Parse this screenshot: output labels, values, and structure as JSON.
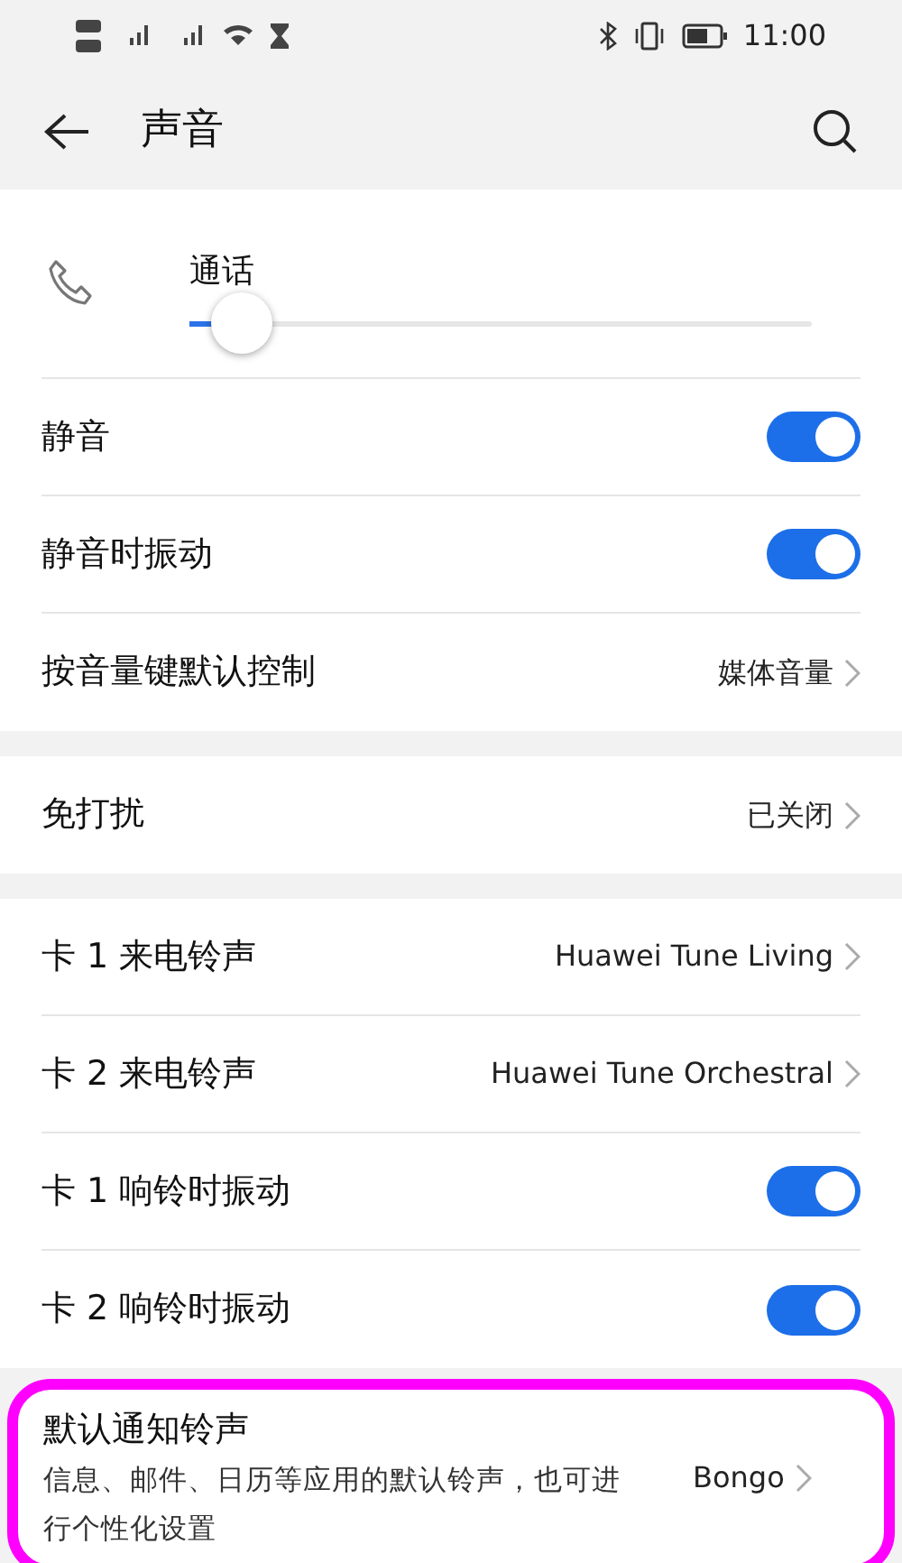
{
  "status_bar": {
    "time": "11:00"
  },
  "header": {
    "title": "声音"
  },
  "groups": [
    {
      "items": [
        {
          "kind": "slider",
          "label": "通话",
          "level": 0.04
        },
        {
          "kind": "toggle",
          "label": "静音",
          "on": true
        },
        {
          "kind": "toggle",
          "label": "静音时振动",
          "on": true
        },
        {
          "kind": "link",
          "label": "按音量键默认控制",
          "value": "媒体音量"
        }
      ]
    },
    {
      "items": [
        {
          "kind": "link",
          "label": "免打扰",
          "value": "已关闭"
        }
      ]
    },
    {
      "items": [
        {
          "kind": "link",
          "label": "卡 1 来电铃声",
          "value": "Huawei Tune Living"
        },
        {
          "kind": "link",
          "label": "卡 2 来电铃声",
          "value": "Huawei Tune Orchestral"
        },
        {
          "kind": "toggle",
          "label": "卡 1 响铃时振动",
          "on": true
        },
        {
          "kind": "toggle",
          "label": "卡 2 响铃时振动",
          "on": true
        }
      ]
    },
    {
      "highlighted": true,
      "items": [
        {
          "kind": "detail",
          "label": "默认通知铃声",
          "description": "信息、邮件、日历等应用的默认铃声，也可进行个性化设置",
          "value": "Bongo"
        }
      ]
    }
  ]
}
